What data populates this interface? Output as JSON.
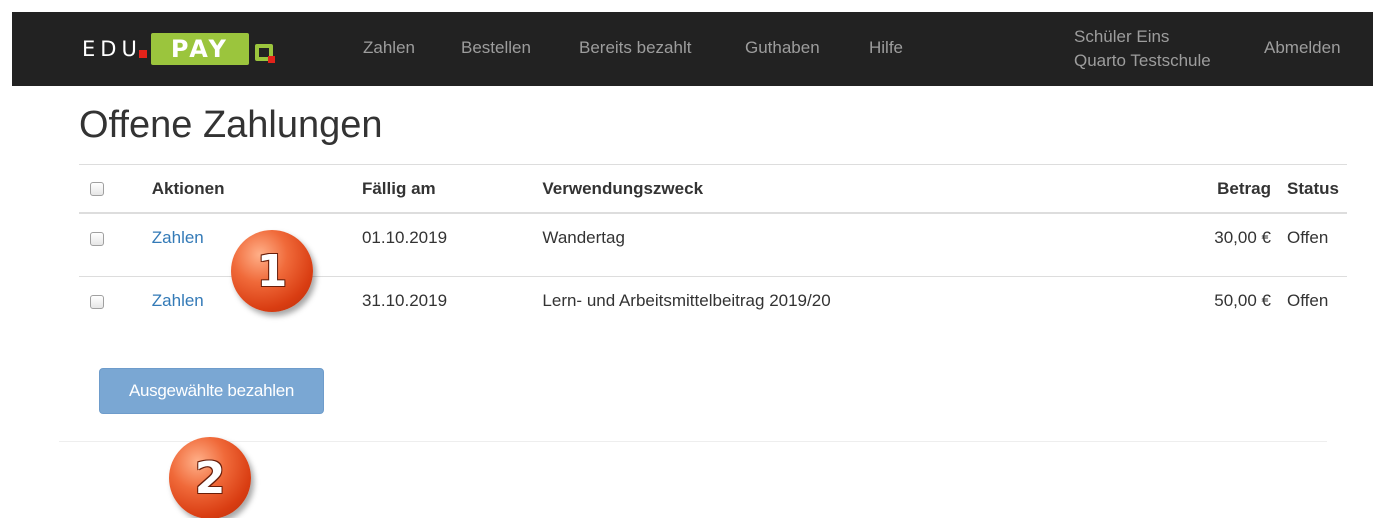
{
  "brand": {
    "edu": "EDU",
    "pay": "PAY",
    "accent_green": "#9bc53d",
    "accent_red": "#e2231a"
  },
  "nav": {
    "links": [
      "Zahlen",
      "Bestellen",
      "Bereits bezahlt",
      "Guthaben",
      "Hilfe"
    ],
    "user_name": "Schüler Eins",
    "school": "Quarto Testschule",
    "logout": "Abmelden"
  },
  "page": {
    "title": "Offene Zahlungen"
  },
  "table": {
    "headers": {
      "actions": "Aktionen",
      "due": "Fällig am",
      "purpose": "Verwendungszweck",
      "amount": "Betrag",
      "status": "Status"
    },
    "rows": [
      {
        "action": "Zahlen",
        "due": "01.10.2019",
        "purpose": "Wandertag",
        "amount": "30,00 €",
        "status": "Offen"
      },
      {
        "action": "Zahlen",
        "due": "31.10.2019",
        "purpose": "Lern- und Arbeitsmittelbeitrag 2019/20",
        "amount": "50,00 €",
        "status": "Offen"
      }
    ]
  },
  "actions": {
    "pay_selected": "Ausgewählte bezahlen"
  },
  "callouts": [
    "1",
    "2"
  ]
}
